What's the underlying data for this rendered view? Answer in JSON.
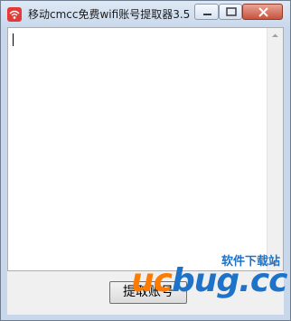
{
  "window": {
    "title": "移动cmcc免费wifi账号提取器3.5",
    "icon": "wifi-icon"
  },
  "title_controls": {
    "minimize": "minimize-icon",
    "maximize": "maximize-icon",
    "close": "close-icon"
  },
  "output_text": {
    "value": ""
  },
  "button": {
    "label": "提取账号"
  },
  "watermark": {
    "brand_a": "uc",
    "brand_b": "bug",
    "brand_c": ".cc",
    "site": "软件下载站"
  },
  "colors": {
    "accent": "#e53935",
    "watermark_orange": "#ff7a00",
    "watermark_blue": "#1e73c9"
  }
}
